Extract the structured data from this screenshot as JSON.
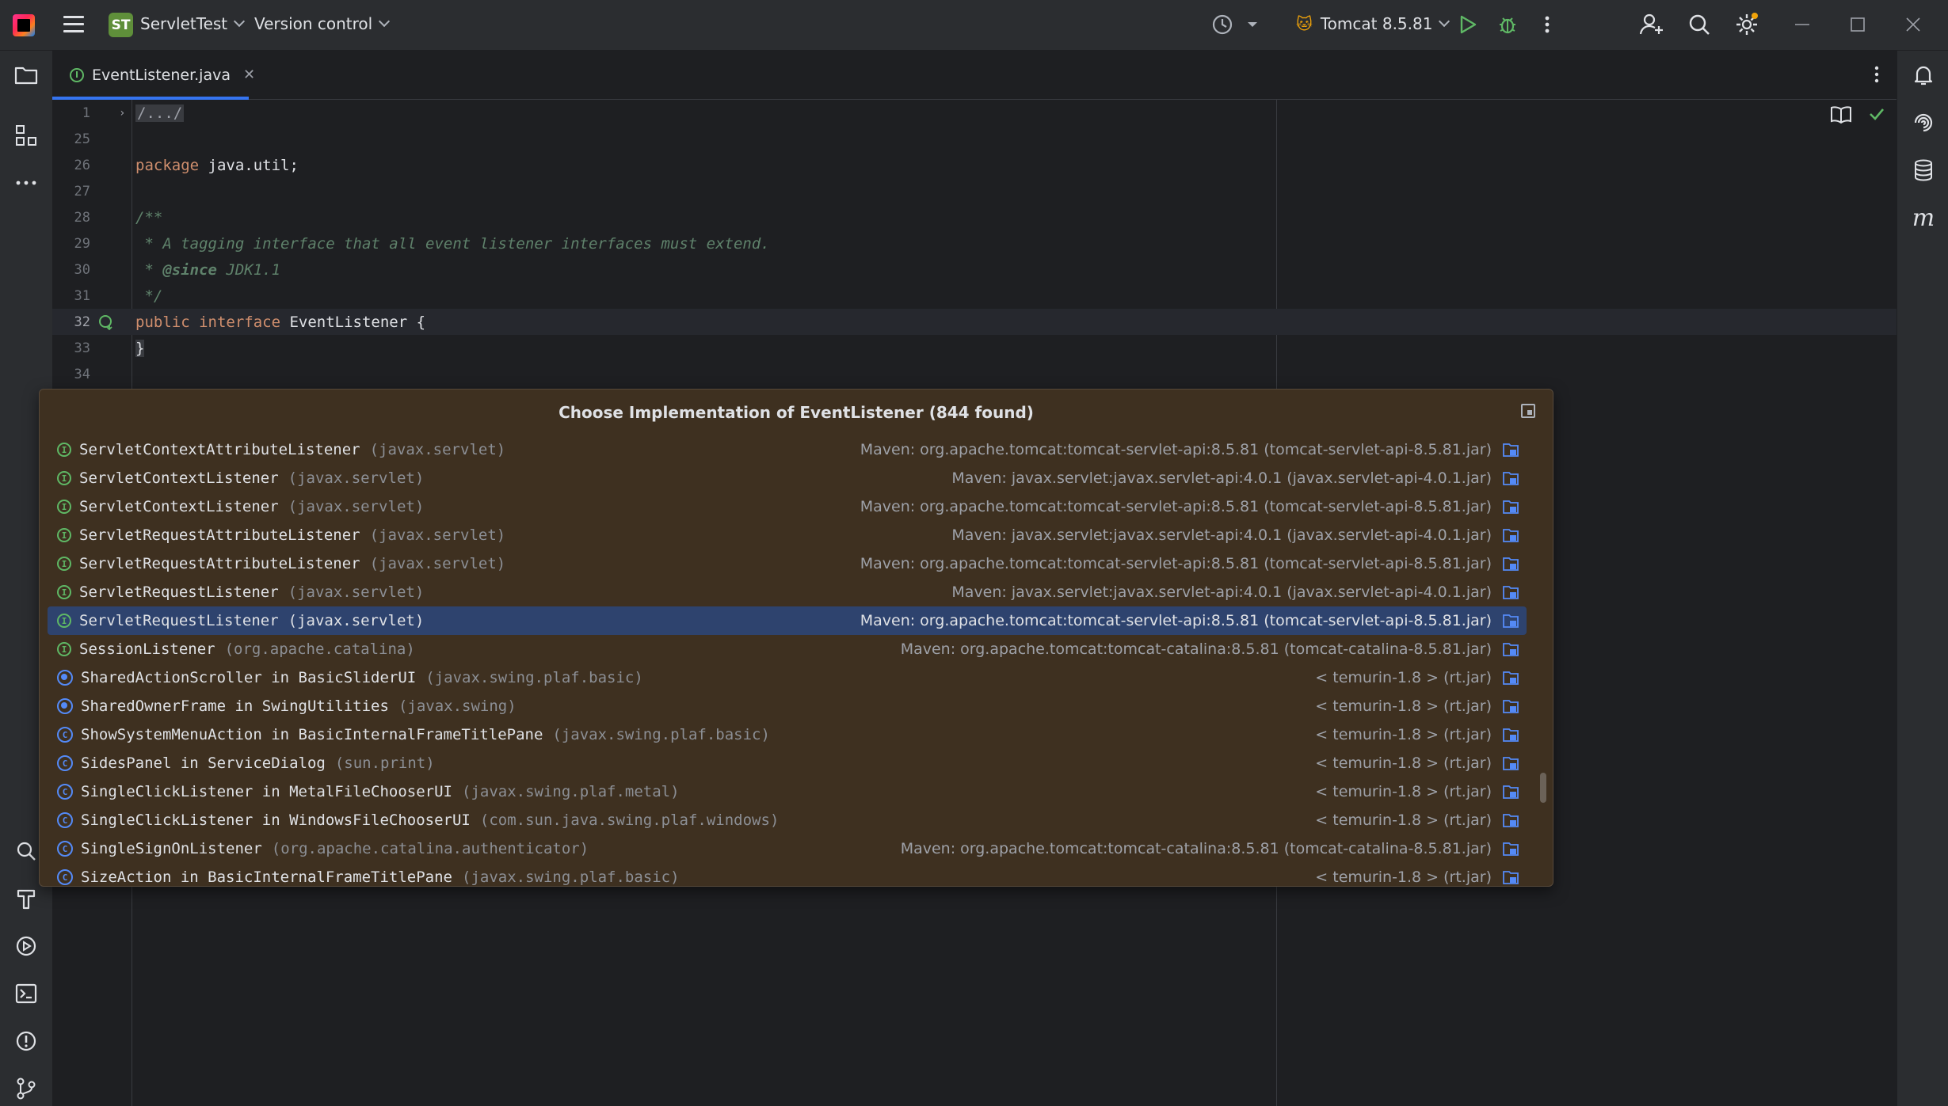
{
  "titlebar": {
    "project_badge": "ST",
    "project_name": "ServletTest",
    "vcs_label": "Version control",
    "run_config": "Tomcat 8.5.81"
  },
  "tab": {
    "label": "EventListener.java",
    "icon_letter": "I"
  },
  "editor": {
    "lines": [
      {
        "n": "1",
        "folded": "/.../"
      },
      {
        "n": "25"
      },
      {
        "n": "26",
        "kw": "package",
        "text": " java.util;"
      },
      {
        "n": "27"
      },
      {
        "n": "28",
        "doc": "/**"
      },
      {
        "n": "29",
        "doc": " * A tagging interface that all event listener interfaces must extend."
      },
      {
        "n": "30",
        "doc_pre": " * ",
        "doctag": "@since",
        "doc_post": " JDK1.1"
      },
      {
        "n": "31",
        "doc": " */"
      },
      {
        "n": "32",
        "kw": "public interface",
        "text": " EventListener {"
      },
      {
        "n": "33",
        "text": "}"
      },
      {
        "n": "34"
      }
    ]
  },
  "popup": {
    "title": "Choose Implementation of EventListener (844 found)",
    "rows": [
      {
        "kind": "I",
        "name": "ServletContextAttributeListener",
        "pkg": "(javax.servlet)",
        "loc": "Maven: org.apache.tomcat:tomcat-servlet-api:8.5.81 (tomcat-servlet-api-8.5.81.jar)"
      },
      {
        "kind": "I",
        "name": "ServletContextListener",
        "pkg": "(javax.servlet)",
        "loc": "Maven: javax.servlet:javax.servlet-api:4.0.1 (javax.servlet-api-4.0.1.jar)"
      },
      {
        "kind": "I",
        "name": "ServletContextListener",
        "pkg": "(javax.servlet)",
        "loc": "Maven: org.apache.tomcat:tomcat-servlet-api:8.5.81 (tomcat-servlet-api-8.5.81.jar)"
      },
      {
        "kind": "I",
        "name": "ServletRequestAttributeListener",
        "pkg": "(javax.servlet)",
        "loc": "Maven: javax.servlet:javax.servlet-api:4.0.1 (javax.servlet-api-4.0.1.jar)"
      },
      {
        "kind": "I",
        "name": "ServletRequestAttributeListener",
        "pkg": "(javax.servlet)",
        "loc": "Maven: org.apache.tomcat:tomcat-servlet-api:8.5.81 (tomcat-servlet-api-8.5.81.jar)"
      },
      {
        "kind": "I",
        "name": "ServletRequestListener",
        "pkg": "(javax.servlet)",
        "loc": "Maven: javax.servlet:javax.servlet-api:4.0.1 (javax.servlet-api-4.0.1.jar)"
      },
      {
        "kind": "I",
        "name": "ServletRequestListener",
        "pkg": "(javax.servlet)",
        "loc": "Maven: org.apache.tomcat:tomcat-servlet-api:8.5.81 (tomcat-servlet-api-8.5.81.jar)",
        "selected": true
      },
      {
        "kind": "I",
        "name": "SessionListener",
        "pkg": "(org.apache.catalina)",
        "loc": "Maven: org.apache.tomcat:tomcat-catalina:8.5.81 (tomcat-catalina-8.5.81.jar)"
      },
      {
        "kind": "A",
        "name": "SharedActionScroller in BasicSliderUI",
        "pkg": "(javax.swing.plaf.basic)",
        "loc": "< temurin-1.8 > (rt.jar)"
      },
      {
        "kind": "A",
        "name": "SharedOwnerFrame in SwingUtilities",
        "pkg": "(javax.swing)",
        "loc": "< temurin-1.8 > (rt.jar)"
      },
      {
        "kind": "C",
        "name": "ShowSystemMenuAction in BasicInternalFrameTitlePane",
        "pkg": "(javax.swing.plaf.basic)",
        "loc": "< temurin-1.8 > (rt.jar)"
      },
      {
        "kind": "C",
        "name": "SidesPanel in ServiceDialog",
        "pkg": "(sun.print)",
        "loc": "< temurin-1.8 > (rt.jar)"
      },
      {
        "kind": "C",
        "name": "SingleClickListener in MetalFileChooserUI",
        "pkg": "(javax.swing.plaf.metal)",
        "loc": "< temurin-1.8 > (rt.jar)"
      },
      {
        "kind": "C",
        "name": "SingleClickListener in WindowsFileChooserUI",
        "pkg": "(com.sun.java.swing.plaf.windows)",
        "loc": "< temurin-1.8 > (rt.jar)"
      },
      {
        "kind": "C",
        "name": "SingleSignOnListener",
        "pkg": "(org.apache.catalina.authenticator)",
        "loc": "Maven: org.apache.tomcat:tomcat-catalina:8.5.81 (tomcat-catalina-8.5.81.jar)"
      },
      {
        "kind": "C",
        "name": "SizeAction in BasicInternalFrameTitlePane",
        "pkg": "(javax.swing.plaf.basic)",
        "loc": "< temurin-1.8 > (rt.jar)"
      }
    ]
  },
  "colors": {
    "accent": "#3574f0",
    "popup_bg": "#3e3020",
    "selection": "#2e436e",
    "interface_badge": "#5fb865",
    "class_badge": "#548af7"
  }
}
